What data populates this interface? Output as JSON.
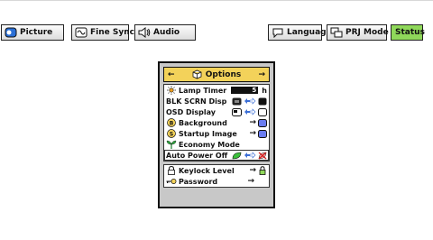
{
  "tabs": [
    {
      "label": "Picture",
      "icon": "picture-icon"
    },
    {
      "label": "Fine Sync",
      "icon": "fine-sync-icon"
    },
    {
      "label": "Audio",
      "icon": "audio-icon"
    },
    {
      "label": "Language",
      "icon": "language-icon"
    },
    {
      "label": "PRJ Mode",
      "icon": "prj-mode-icon"
    },
    {
      "label": "Status",
      "icon": ""
    }
  ],
  "menu": {
    "title": "Options",
    "items": [
      {
        "label": "Lamp Timer",
        "value": "5",
        "unit": "h"
      },
      {
        "label": "BLK SCRN Disp"
      },
      {
        "label": "OSD Display"
      },
      {
        "label": "Background"
      },
      {
        "label": "Startup Image"
      },
      {
        "label": "Economy Mode"
      },
      {
        "label": "Auto Power Off"
      },
      {
        "label": "Keylock Level"
      },
      {
        "label": "Password"
      }
    ]
  },
  "colors": {
    "active_tab": "#8fd85a",
    "title_bar": "#f3d25a",
    "menu_frame": "#c8c8c8"
  }
}
